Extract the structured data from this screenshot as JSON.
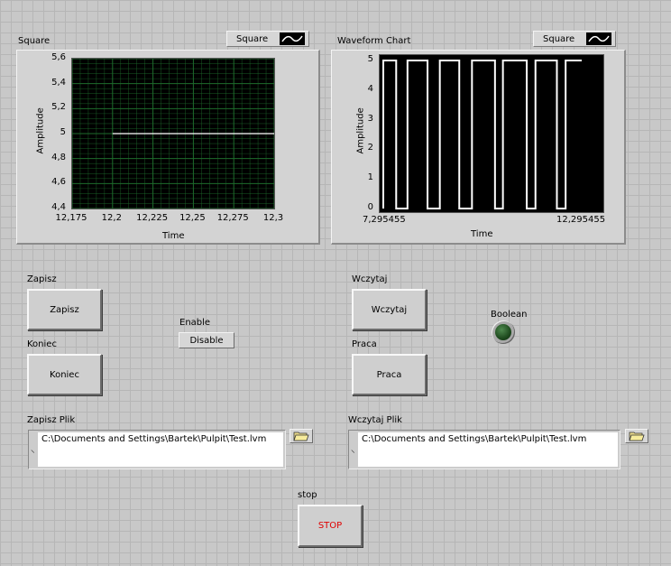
{
  "graph1": {
    "label": "Square",
    "legend": "Square",
    "xlabel": "Time",
    "ylabel": "Amplitude"
  },
  "graph2": {
    "label": "Waveform Chart",
    "legend": "Square",
    "xlabel": "Time",
    "ylabel": "Amplitude"
  },
  "chart_data": [
    {
      "type": "line",
      "title": "Square",
      "xlabel": "Time",
      "ylabel": "Amplitude",
      "xlim": [
        12.175,
        12.3
      ],
      "ylim": [
        4.4,
        5.6
      ],
      "x_ticks": [
        "12,175",
        "12,2",
        "12,225",
        "12,25",
        "12,275",
        "12,3"
      ],
      "y_ticks": [
        "4,4",
        "4,6",
        "4,8",
        "5",
        "5,2",
        "5,4",
        "5,6"
      ],
      "grid": true,
      "plot_background": "#000000",
      "grid_color": "#1e6b2c",
      "series": [
        {
          "name": "Square",
          "color": "#ffffff",
          "x": [
            12.2,
            12.3
          ],
          "y": [
            5,
            5
          ]
        }
      ]
    },
    {
      "type": "line",
      "title": "Waveform Chart",
      "xlabel": "Time",
      "ylabel": "Amplitude",
      "xlim": [
        7.295455,
        12.295455
      ],
      "ylim": [
        0,
        5
      ],
      "x_ticks": [
        "7,295455",
        "12,295455"
      ],
      "y_ticks": [
        "0",
        "1",
        "2",
        "3",
        "4",
        "5"
      ],
      "grid": false,
      "plot_background": "#000000",
      "series": [
        {
          "name": "Square",
          "color": "#ffffff",
          "x": [
            7.295455,
            7.295455,
            7.62,
            7.62,
            7.905,
            7.905,
            8.41,
            8.41,
            8.72,
            8.72,
            9.21,
            9.21,
            9.53,
            9.53,
            10.11,
            10.11,
            10.31,
            10.31,
            10.91,
            10.91,
            11.13,
            11.13,
            11.67,
            11.67,
            11.89,
            11.89,
            12.295455
          ],
          "y": [
            0,
            5,
            5,
            0,
            0,
            5,
            5,
            0,
            0,
            5,
            5,
            0,
            0,
            5,
            5,
            0,
            0,
            5,
            5,
            0,
            0,
            5,
            5,
            0,
            0,
            5,
            5
          ]
        }
      ]
    }
  ],
  "controls": {
    "zapisz": {
      "label": "Zapisz",
      "button": "Zapisz"
    },
    "koniec": {
      "label": "Koniec",
      "button": "Koniec"
    },
    "enable": {
      "label": "Enable",
      "button": "Disable"
    },
    "wczytaj": {
      "label": "Wczytaj",
      "button": "Wczytaj"
    },
    "praca": {
      "label": "Praca",
      "button": "Praca"
    },
    "boolean": {
      "label": "Boolean",
      "state": "off",
      "color": "#1e4a1e"
    },
    "zapisz_plik": {
      "label": "Zapisz Plik",
      "value": "C:\\Documents and Settings\\Bartek\\Pulpit\\Test.lvm"
    },
    "wczytaj_plik": {
      "label": "Wczytaj Plik",
      "value": "C:\\Documents and Settings\\Bartek\\Pulpit\\Test.lvm"
    },
    "stop": {
      "label": "stop",
      "button": "STOP",
      "color": "#e00000"
    }
  }
}
